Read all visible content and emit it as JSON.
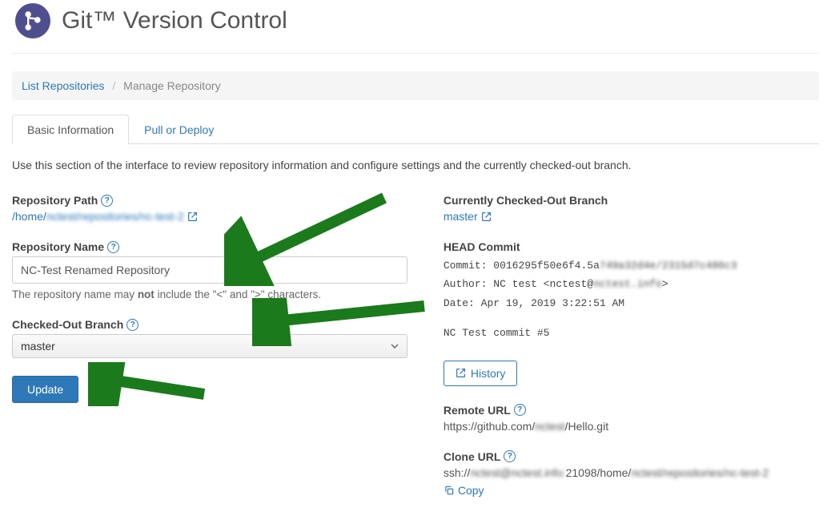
{
  "header": {
    "title": "Git™ Version Control"
  },
  "breadcrumb": {
    "link": "List Repositories",
    "active": "Manage Repository"
  },
  "tabs": [
    {
      "label": "Basic Information",
      "active": true
    },
    {
      "label": "Pull or Deploy",
      "active": false
    }
  ],
  "description": "Use this section of the interface to review repository information and configure settings and the currently checked-out branch.",
  "left": {
    "repo_path_label": "Repository Path",
    "repo_path_prefix": "/home/",
    "repo_path_blurred": "nctest/repositories/nc-test-2",
    "repo_name_label": "Repository Name",
    "repo_name_value": "NC-Test Renamed Repository",
    "repo_name_help_pre": "The repository name may ",
    "repo_name_help_bold": "not",
    "repo_name_help_post": " include the \"<\" and \">\" characters.",
    "branch_label": "Checked-Out Branch",
    "branch_value": "master",
    "update_label": "Update"
  },
  "right": {
    "curr_branch_label": "Currently Checked-Out Branch",
    "curr_branch_value": "master",
    "head_commit_label": "HEAD Commit",
    "commit_prefix": "Commit:",
    "commit_hash_visible": "0016295f50e6f4.5a",
    "commit_hash_blurred": "749a32d4e/2315d7c486c3",
    "author_prefix": "Author:",
    "author_value_visible": "NC test <nctest@",
    "author_value_blurred": "nctest.info",
    "author_value_close": ">",
    "date_prefix": "Date:",
    "date_value": "Apr 19, 2019 3:22:51 AM",
    "commit_msg": "NC Test commit #5",
    "history_label": "History",
    "remote_url_label": "Remote URL",
    "remote_url_prefix": "https://github.com/",
    "remote_url_blurred": "nctest",
    "remote_url_suffix": "/Hello.git",
    "clone_url_label": "Clone URL",
    "clone_url_prefix": "ssh://",
    "clone_url_blur1": "nctest@nctest.info:",
    "clone_url_mid": "21098/home/",
    "clone_url_blur2": "nctest/repositories/nc-test-2",
    "copy_label": "Copy"
  }
}
